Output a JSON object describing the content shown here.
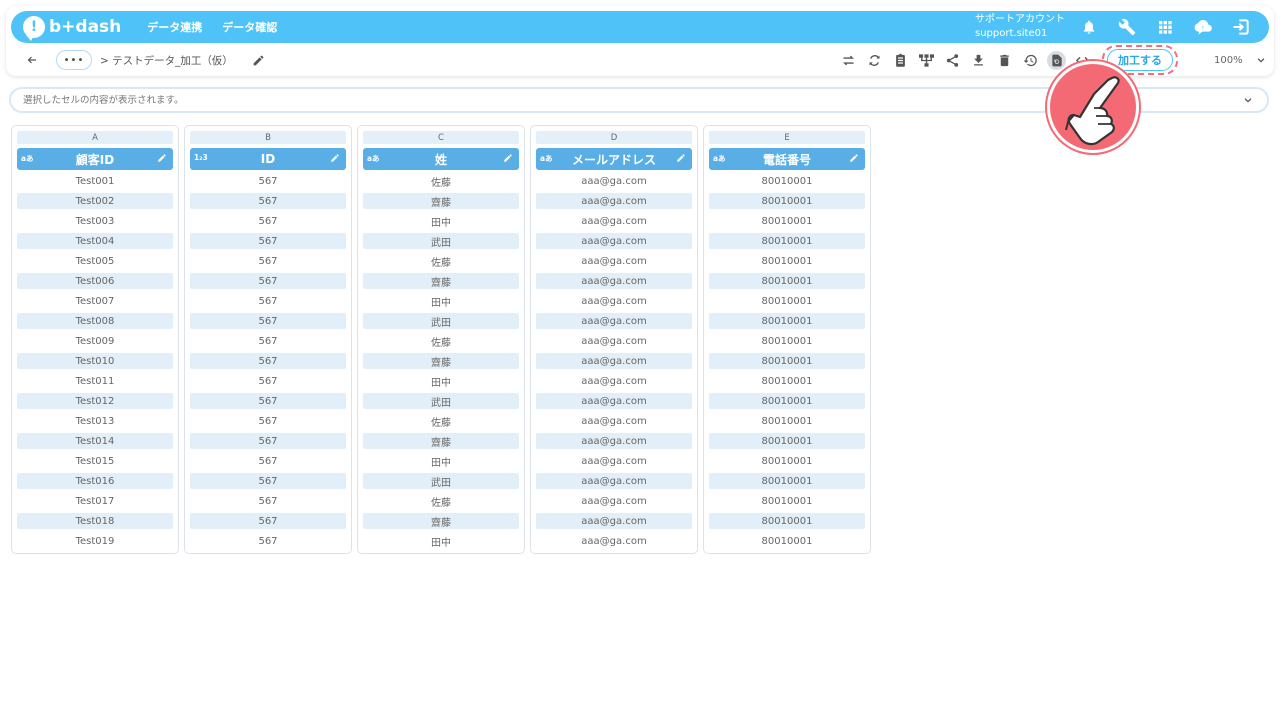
{
  "app": {
    "logo_text": "b+dash"
  },
  "topnav": [
    {
      "label": "データ連携"
    },
    {
      "label": "データ確認"
    }
  ],
  "account": {
    "name": "サポートアカウント",
    "site": "support.site01"
  },
  "top_icons": [
    "bell-icon",
    "wrench-icon",
    "grid-icon",
    "cloud-chat-icon",
    "logout-icon"
  ],
  "toolbar": {
    "more_label": "•••",
    "breadcrumb": "> テストデータ_加工（仮）",
    "process_label": "加工する",
    "zoom_value": "100%"
  },
  "tool_icons": [
    "swap-icon",
    "sync-icon",
    "clipboard-icon",
    "hierarchy-icon",
    "share-icon",
    "download-icon",
    "trash-icon",
    "history-icon",
    "refresh-doc-icon",
    "code-icon"
  ],
  "content_bar": {
    "placeholder": "選択したセルの内容が表示されます。"
  },
  "columns": [
    {
      "letter": "A",
      "type": "aあ",
      "title": "顧客ID",
      "rows": [
        "Test001",
        "Test002",
        "Test003",
        "Test004",
        "Test005",
        "Test006",
        "Test007",
        "Test008",
        "Test009",
        "Test010",
        "Test011",
        "Test012",
        "Test013",
        "Test014",
        "Test015",
        "Test016",
        "Test017",
        "Test018",
        "Test019"
      ]
    },
    {
      "letter": "B",
      "type": "1₂3",
      "title": "ID",
      "rows": [
        "567",
        "567",
        "567",
        "567",
        "567",
        "567",
        "567",
        "567",
        "567",
        "567",
        "567",
        "567",
        "567",
        "567",
        "567",
        "567",
        "567",
        "567",
        "567"
      ]
    },
    {
      "letter": "C",
      "type": "aあ",
      "title": "姓",
      "rows": [
        "佐藤",
        "齋藤",
        "田中",
        "武田",
        "佐藤",
        "齋藤",
        "田中",
        "武田",
        "佐藤",
        "齋藤",
        "田中",
        "武田",
        "佐藤",
        "齋藤",
        "田中",
        "武田",
        "佐藤",
        "齋藤",
        "田中"
      ]
    },
    {
      "letter": "D",
      "type": "aあ",
      "title": "メールアドレス",
      "rows": [
        "aaa@ga.com",
        "aaa@ga.com",
        "aaa@ga.com",
        "aaa@ga.com",
        "aaa@ga.com",
        "aaa@ga.com",
        "aaa@ga.com",
        "aaa@ga.com",
        "aaa@ga.com",
        "aaa@ga.com",
        "aaa@ga.com",
        "aaa@ga.com",
        "aaa@ga.com",
        "aaa@ga.com",
        "aaa@ga.com",
        "aaa@ga.com",
        "aaa@ga.com",
        "aaa@ga.com",
        "aaa@ga.com"
      ]
    },
    {
      "letter": "E",
      "type": "aあ",
      "title": "電話番号",
      "rows": [
        "80010001",
        "80010001",
        "80010001",
        "80010001",
        "80010001",
        "80010001",
        "80010001",
        "80010001",
        "80010001",
        "80010001",
        "80010001",
        "80010001",
        "80010001",
        "80010001",
        "80010001",
        "80010001",
        "80010001",
        "80010001",
        "80010001"
      ]
    }
  ],
  "colors": {
    "topbar": "#4fc3f7",
    "column_header": "#5aaee6",
    "row_alt": "#e2eef8",
    "highlight": "#f46a74"
  }
}
